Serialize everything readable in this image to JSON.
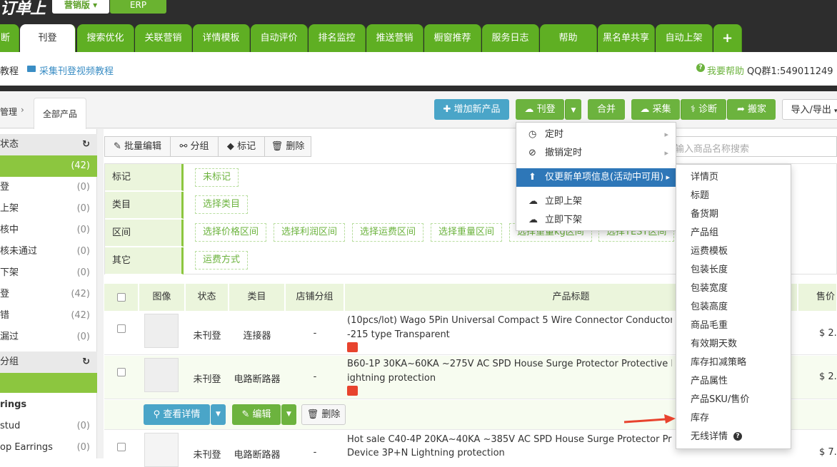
{
  "logo": {
    "text": "订单上"
  },
  "versions": {
    "marketing": "营销版 ▾",
    "erp": "ERP"
  },
  "nav": {
    "tabs": [
      "断",
      "刊登",
      "搜索优化",
      "关联营销",
      "详情模板",
      "自动评价",
      "排名监控",
      "推送营销",
      "橱窗推荐",
      "服务日志",
      "帮助",
      "黑名单共享",
      "自动上架",
      "+"
    ]
  },
  "subbar": {
    "tutorial": "教程",
    "video": "采集刊登视频教程",
    "help": "我要帮助",
    "qq": "QQ群1:549011249"
  },
  "breadcrumb": {
    "parent": "管理",
    "current": "全部产品"
  },
  "actions": {
    "add": "增加新产品",
    "publish": "刊登",
    "merge": "合并",
    "collect": "采集",
    "diagnose": "诊断",
    "move": "搬家",
    "import": "导入/导出"
  },
  "search": {
    "placeholder": "输入商品名称搜索"
  },
  "sidebar": {
    "status_title": "状态",
    "status_items": [
      {
        "label": "",
        "count": "(42)"
      },
      {
        "label": "登",
        "count": "(0)"
      },
      {
        "label": "上架",
        "count": "(0)"
      },
      {
        "label": "核中",
        "count": "(0)"
      },
      {
        "label": "核未通过",
        "count": "(0)"
      },
      {
        "label": "下架",
        "count": "(0)"
      },
      {
        "label": "登",
        "count": "(42)"
      },
      {
        "label": "错",
        "count": "(42)"
      },
      {
        "label": "漏过",
        "count": "(0)"
      }
    ],
    "group_title": "分组",
    "group_items": [
      {
        "label": "rings",
        "count": ""
      },
      {
        "label": " stud",
        "count": "(0)"
      },
      {
        "label": "op Earrings",
        "count": "(0)"
      }
    ]
  },
  "toolbar": {
    "batch_edit": "批量编辑",
    "group": "分组",
    "tag": "标记",
    "delete": "删除"
  },
  "filters": [
    {
      "label": "标记",
      "tags": [
        "未标记"
      ]
    },
    {
      "label": "类目",
      "tags": [
        "选择类目"
      ]
    },
    {
      "label": "区间",
      "tags": [
        "选择价格区间",
        "选择利润区间",
        "选择运费区间",
        "选择重量区间",
        "选择重量kg区间",
        "选择TEST区间"
      ]
    },
    {
      "label": "其它",
      "tags": [
        "运费方式"
      ]
    }
  ],
  "table": {
    "headers": [
      "图像",
      "状态",
      "类目",
      "店铺分组",
      "产品标题",
      "售价"
    ],
    "rows": [
      {
        "status": "未刊登",
        "category": "连接器",
        "group": "-",
        "title1": "(10pcs/lot) Wago 5Pin Universal Compact 5 Wire Connector Conductor Ter",
        "title2": "-215 type Transparent",
        "price": "$ 2."
      },
      {
        "status": "未刊登",
        "category": "电路断路器",
        "group": "-",
        "title1": "B60-1P 30KA~60KA ~275V AC SPD House Surge Protector Protective Low",
        "title2": "ightning protection",
        "price": "$ 2."
      },
      {
        "status": "未刊登",
        "category": "电路断路器",
        "group": "-",
        "title1": "Hot sale C40-4P 20KA~40KA ~385V AC SPD House Surge Protector Prote",
        "title2": "Device 3P+N Lightning protection",
        "price": "$ 7."
      }
    ],
    "row_actions": {
      "view": "查看详情",
      "edit": "编辑",
      "delete": "删除"
    }
  },
  "publish_menu": {
    "items": [
      "定时",
      "撤销定时",
      "仅更新单项信息(活动中可用)",
      "立即上架",
      "立即下架"
    ]
  },
  "update_submenu": {
    "items": [
      "详情页",
      "标题",
      "备货期",
      "产品组",
      "运费模板",
      "包装长度",
      "包装宽度",
      "包装高度",
      "商品毛重",
      "有效期天数",
      "库存扣减策略",
      "产品属性",
      "产品SKU/售价",
      "库存",
      "无线详情"
    ]
  },
  "colors": {
    "brand_green": "#6cb33e",
    "nav_dark": "#2d2d2d",
    "teal": "#4aa5c8",
    "menu_active": "#2e77b8",
    "arrow": "#e8432e"
  }
}
